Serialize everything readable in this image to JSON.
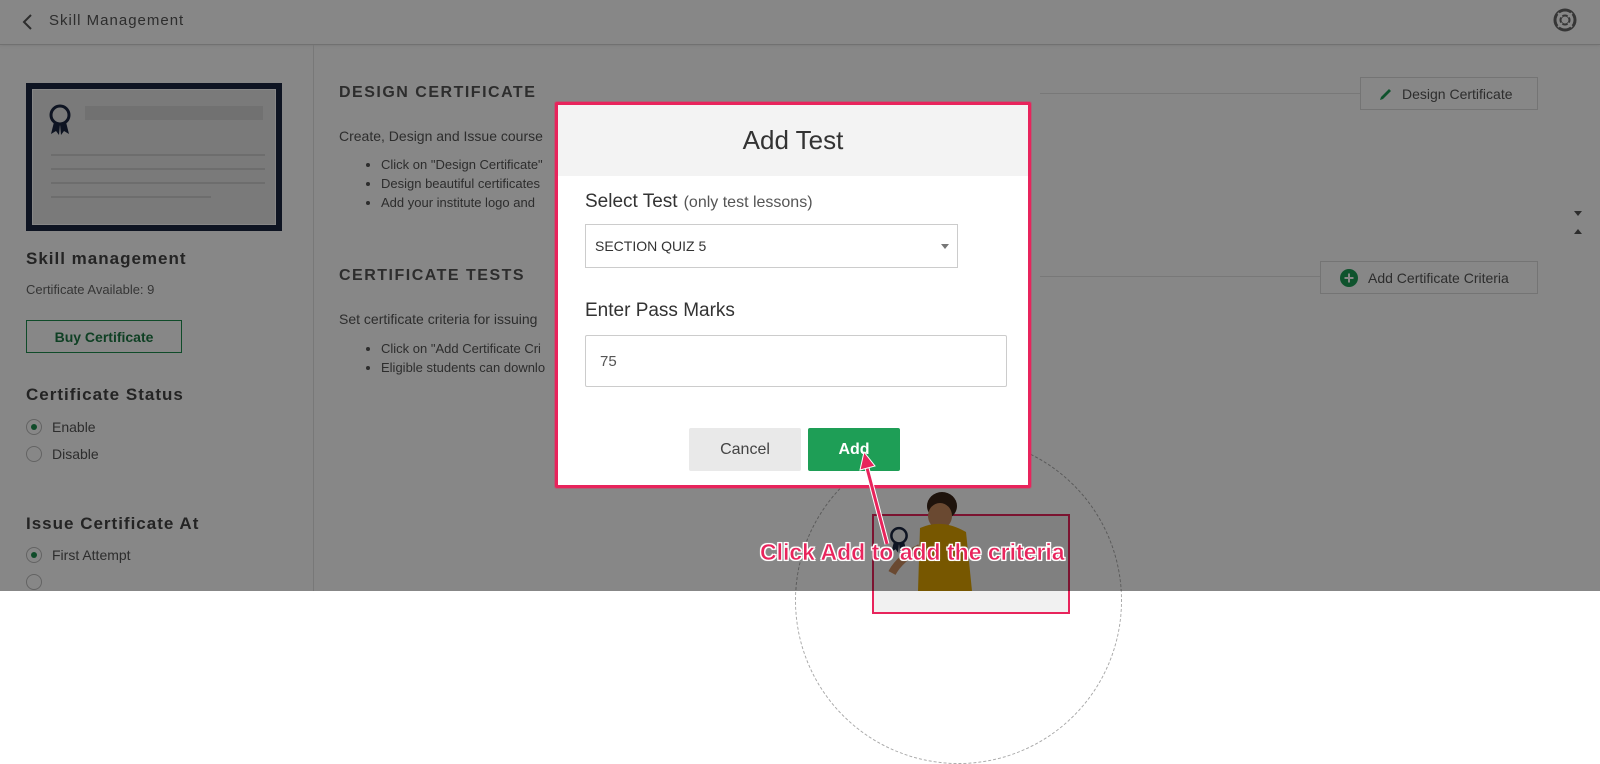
{
  "topbar": {
    "title": "Skill Management"
  },
  "sidebar": {
    "title": "Skill management",
    "certificates_available": "Certificate Available: 9",
    "buy_button": "Buy Certificate",
    "status_title": "Certificate Status",
    "status_options": [
      {
        "label": "Enable",
        "selected": true
      },
      {
        "label": "Disable",
        "selected": false
      }
    ],
    "issue_title": "Issue Certificate At",
    "issue_options": [
      {
        "label": "First Attempt",
        "selected": true
      }
    ]
  },
  "main": {
    "design_heading": "DESIGN CERTIFICATE",
    "design_button": "Design Certificate",
    "design_intro": "Create, Design and Issue course",
    "design_bullets": [
      "Click on \"Design Certificate\"",
      "Design beautiful certificates",
      "Add your institute logo and"
    ],
    "tests_heading": "CERTIFICATE TESTS",
    "tests_button": "Add Certificate Criteria",
    "tests_intro": "Set certificate criteria for issuing",
    "tests_bullets": [
      "Click on \"Add Certificate Cri",
      "Eligible students can downlo"
    ]
  },
  "modal": {
    "title": "Add Test",
    "select_label": "Select Test",
    "select_hint": "(only test lessons)",
    "select_value": "SECTION QUIZ 5",
    "pass_label": "Enter Pass Marks",
    "pass_value": "75",
    "cancel_label": "Cancel",
    "add_label": "Add"
  },
  "annotation": {
    "text": "Click Add to add the criteria"
  },
  "colors": {
    "accent_green": "#1e9e56",
    "highlight": "#e8245c",
    "overlay": "rgba(0,0,0,0.47)"
  },
  "icons": [
    "chevron-left-icon",
    "help-lifebuoy-icon",
    "pencil-icon",
    "plus-circle-icon",
    "ribbon-icon",
    "chevron-down-icon"
  ]
}
